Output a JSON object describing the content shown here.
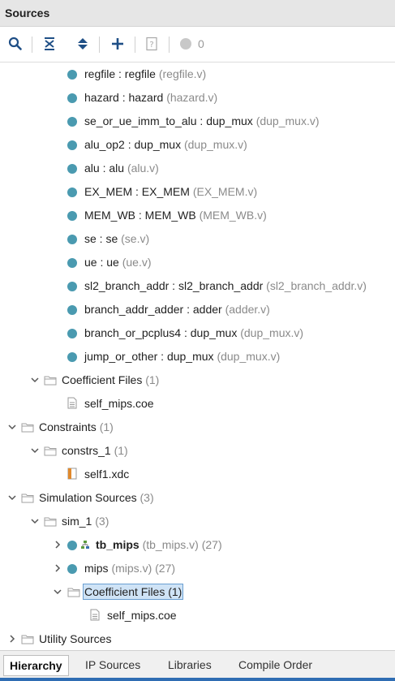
{
  "panel": {
    "title": "Sources",
    "error_count": "0"
  },
  "colors": {
    "accent": "#2f6db3",
    "module_dot": "#4a9ab0",
    "selection": "#cfe3f6"
  },
  "tree": {
    "r1": {
      "name": "regfile : regfile",
      "file": "(regfile.v)"
    },
    "r2": {
      "name": "hazard : hazard",
      "file": "(hazard.v)"
    },
    "r3": {
      "name": "se_or_ue_imm_to_alu : dup_mux",
      "file": "(dup_mux.v)"
    },
    "r4": {
      "name": "alu_op2 : dup_mux",
      "file": "(dup_mux.v)"
    },
    "r5": {
      "name": "alu : alu",
      "file": "(alu.v)"
    },
    "r6": {
      "name": "EX_MEM : EX_MEM",
      "file": "(EX_MEM.v)"
    },
    "r7": {
      "name": "MEM_WB : MEM_WB",
      "file": "(MEM_WB.v)"
    },
    "r8": {
      "name": "se : se",
      "file": "(se.v)"
    },
    "r9": {
      "name": "ue : ue",
      "file": "(ue.v)"
    },
    "r10": {
      "name": "sl2_branch_addr : sl2_branch_addr",
      "file": "(sl2_branch_addr.v)"
    },
    "r11": {
      "name": "branch_addr_adder : adder",
      "file": "(adder.v)"
    },
    "r12": {
      "name": "branch_or_pcplus4 : dup_mux",
      "file": "(dup_mux.v)"
    },
    "r13": {
      "name": "jump_or_other : dup_mux",
      "file": "(dup_mux.v)"
    },
    "r14": {
      "name": "Coefficient Files",
      "count": "(1)"
    },
    "r15": {
      "name": "self_mips.coe"
    },
    "r16": {
      "name": "Constraints",
      "count": "(1)"
    },
    "r17": {
      "name": "constrs_1",
      "count": "(1)"
    },
    "r18": {
      "name": "self1.xdc"
    },
    "r19": {
      "name": "Simulation Sources",
      "count": "(3)"
    },
    "r20": {
      "name": "sim_1",
      "count": "(3)"
    },
    "r21": {
      "name": "tb_mips",
      "file": "(tb_mips.v)",
      "count": "(27)"
    },
    "r22": {
      "name": "mips",
      "file": "(mips.v)",
      "count": "(27)"
    },
    "r23": {
      "name": "Coefficient Files (1)"
    },
    "r24": {
      "name": "self_mips.coe"
    },
    "r25": {
      "name": "Utility Sources"
    }
  },
  "tabs": [
    "Hierarchy",
    "IP Sources",
    "Libraries",
    "Compile Order"
  ]
}
